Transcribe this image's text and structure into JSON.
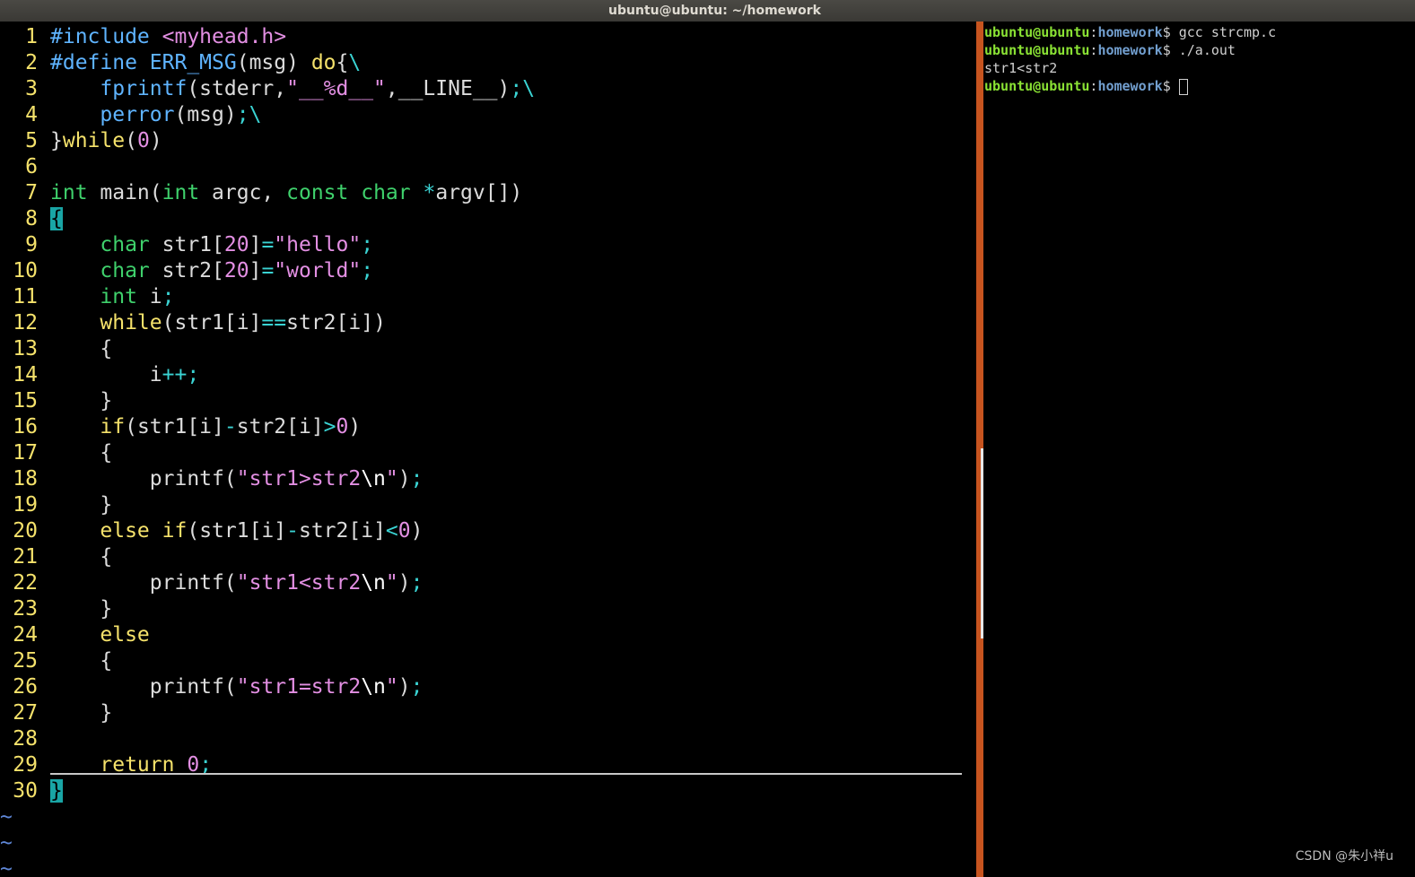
{
  "window": {
    "title": "ubuntu@ubuntu: ~/homework"
  },
  "editor": {
    "line_numbers": [
      "1",
      "2",
      "3",
      "4",
      "5",
      "6",
      "7",
      "8",
      "9",
      "10",
      "11",
      "12",
      "13",
      "14",
      "15",
      "16",
      "17",
      "18",
      "19",
      "20",
      "21",
      "22",
      "23",
      "24",
      "25",
      "26",
      "27",
      "28",
      "29",
      "30"
    ],
    "lines": [
      "#include <myhead.h>",
      "#define ERR_MSG(msg) do{\\",
      "    fprintf(stderr,\"__%d__\",__LINE__);\\",
      "    perror(msg);\\",
      "}while(0)",
      "",
      "int main(int argc, const char *argv[])",
      "{",
      "    char str1[20]=\"hello\";",
      "    char str2[20]=\"world\";",
      "    int i;",
      "    while(str1[i]==str2[i])",
      "    {",
      "        i++;",
      "    }",
      "    if(str1[i]-str2[i]>0)",
      "    {",
      "        printf(\"str1>str2\\n\");",
      "    }",
      "    else if(str1[i]-str2[i]<0)",
      "    {",
      "        printf(\"str1<str2\\n\");",
      "    }",
      "    else",
      "    {",
      "        printf(\"str1=str2\\n\");",
      "    }",
      "",
      "    return 0;",
      "}"
    ],
    "tilde": "~"
  },
  "terminal": {
    "prompt_user": "ubuntu@ubuntu",
    "prompt_sep": ":",
    "prompt_dir": "homework",
    "prompt_end": "$ ",
    "cmd1": "gcc strcmp.c",
    "cmd2": "./a.out",
    "output1": "str1<str2"
  },
  "watermark": "CSDN @朱小祥u",
  "colors": {
    "line_number": "#f5e26b",
    "keyword": "#f5e26b",
    "type": "#3fd16c",
    "preprocessor": "#5fb4ff",
    "string": "#e38fe3",
    "splitter": "#c7541f",
    "prompt_user": "#8ae234",
    "prompt_dir": "#729fcf"
  }
}
